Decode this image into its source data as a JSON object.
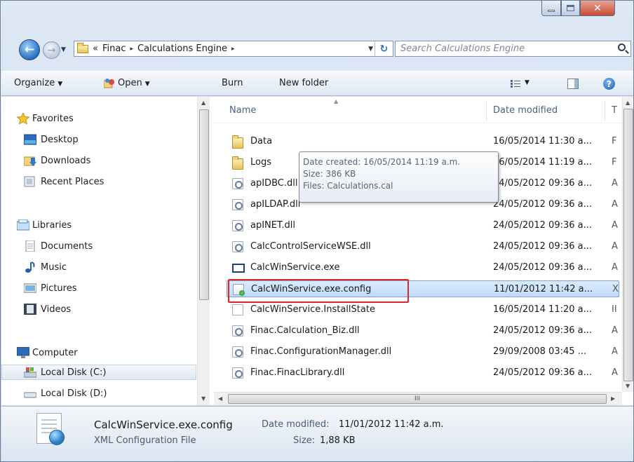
{
  "window": {
    "colors": {
      "accent": "#2a6fc0",
      "selection": "#c1dbfc",
      "highlight_border": "#e0262a",
      "close_button": "#c74c34"
    }
  },
  "address_bar": {
    "overflow_chevron": "«",
    "crumbs": [
      "Finac",
      "Calculations Engine"
    ],
    "separator": "▸"
  },
  "search": {
    "placeholder": "Search Calculations Engine"
  },
  "toolbar": {
    "organize": "Organize",
    "open": "Open",
    "burn": "Burn",
    "new_folder": "New folder"
  },
  "nav_pane": {
    "favorites": {
      "label": "Favorites",
      "icon": "star-icon"
    },
    "favorite_items": [
      {
        "label": "Desktop",
        "icon": "desktop-icon"
      },
      {
        "label": "Downloads",
        "icon": "downloads-icon"
      },
      {
        "label": "Recent Places",
        "icon": "recent-places-icon"
      }
    ],
    "libraries": {
      "label": "Libraries",
      "icon": "libraries-icon"
    },
    "library_items": [
      {
        "label": "Documents",
        "icon": "documents-icon"
      },
      {
        "label": "Music",
        "icon": "music-icon"
      },
      {
        "label": "Pictures",
        "icon": "pictures-icon"
      },
      {
        "label": "Videos",
        "icon": "videos-icon"
      }
    ],
    "computer": {
      "label": "Computer",
      "icon": "computer-icon"
    },
    "computer_items": [
      {
        "label": "Local Disk (C:)",
        "icon": "drive-c-icon",
        "selected": true
      },
      {
        "label": "Local Disk (D:)",
        "icon": "drive-icon",
        "selected": false
      }
    ]
  },
  "file_list": {
    "columns": {
      "name": "Name",
      "date_modified": "Date modified",
      "type": "T"
    },
    "rows": [
      {
        "name": "Data",
        "date": "16/05/2014 11:30 a...",
        "type": "F",
        "icon": "folder-icon"
      },
      {
        "name": "Logs",
        "date": "16/05/2014 11:19 a...",
        "type": "F",
        "icon": "folder-icon"
      },
      {
        "name": "apIDBC.dll",
        "date": "24/05/2012 09:36 a...",
        "type": "A",
        "icon": "dll-icon"
      },
      {
        "name": "apILDAP.dll",
        "date": "24/05/2012 09:36 a...",
        "type": "A",
        "icon": "dll-icon"
      },
      {
        "name": "apINET.dll",
        "date": "24/05/2012 09:36 a...",
        "type": "A",
        "icon": "dll-icon"
      },
      {
        "name": "CalcControlServiceWSE.dll",
        "date": "24/05/2012 09:36 a...",
        "type": "A",
        "icon": "dll-icon"
      },
      {
        "name": "CalcWinService.exe",
        "date": "24/05/2012 09:36 a...",
        "type": "A",
        "icon": "exe-icon"
      },
      {
        "name": "CalcWinService.exe.config",
        "date": "11/01/2012 11:42 a...",
        "type": "X",
        "icon": "config-icon",
        "selected": true
      },
      {
        "name": "CalcWinService.InstallState",
        "date": "16/05/2014 11:20 a...",
        "type": "II",
        "icon": "file-icon"
      },
      {
        "name": "Finac.Calculation_Biz.dll",
        "date": "24/05/2012 09:36 a...",
        "type": "A",
        "icon": "dll-icon"
      },
      {
        "name": "Finac.ConfigurationManager.dll",
        "date": "29/09/2008 03:45 ...",
        "type": "A",
        "icon": "dll-icon"
      },
      {
        "name": "Finac.FinacLibrary.dll",
        "date": "24/05/2012 09:36 a...",
        "type": "A",
        "icon": "dll-icon"
      }
    ]
  },
  "tooltip": {
    "date_created": "Date created: 16/05/2014 11:19 a.m.",
    "size": "Size: 386 KB",
    "files": "Files: Calculations.cal"
  },
  "details_pane": {
    "file_name": "CalcWinService.exe.config",
    "file_type": "XML Configuration File",
    "date_modified_label": "Date modified:",
    "date_modified_value": "11/01/2012 11:42 a.m.",
    "size_label": "Size:",
    "size_value": "1,88 KB"
  },
  "hscroll": {
    "grip": "III"
  }
}
